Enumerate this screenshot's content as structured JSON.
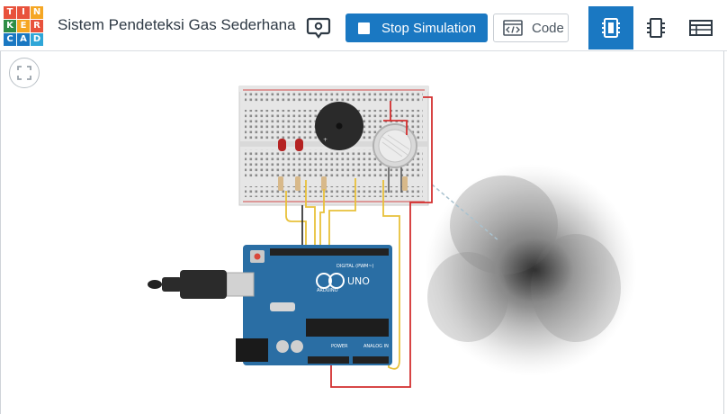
{
  "logo": {
    "letters": [
      "T",
      "I",
      "N",
      "K",
      "E",
      "R",
      "C",
      "A",
      "D"
    ],
    "colors": [
      "#e8523c",
      "#e8523c",
      "#f5a623",
      "#2f8d46",
      "#f5a623",
      "#e8523c",
      "#1a78c2",
      "#1a78c2",
      "#2fa6d8"
    ]
  },
  "header": {
    "title": "Sistem Pendeteksi Gas Sederhana",
    "stop_label": "Stop Simulation",
    "code_label": "Code",
    "accent": "#1a78c2"
  },
  "tabs": [
    {
      "icon": "circuit-view-icon",
      "active": true
    },
    {
      "icon": "component-view-icon",
      "active": false
    },
    {
      "icon": "component-list-icon",
      "active": false
    }
  ],
  "board": {
    "brand": "ARDUINO",
    "model": "UNO",
    "digital_label": "DIGITAL (PWM~)",
    "power_label": "POWER",
    "analog_label": "ANALOG IN"
  }
}
